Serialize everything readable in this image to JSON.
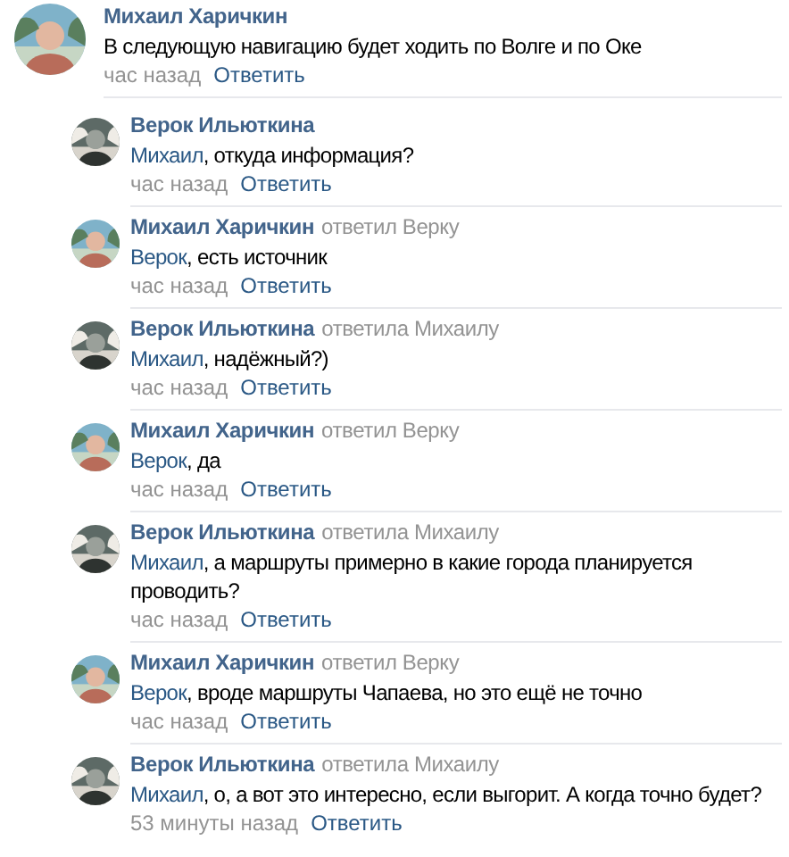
{
  "comment": {
    "author": "Михаил Харичкин",
    "text": "В следующую навигацию будет ходить по Волге и по Оке",
    "time": "час назад",
    "reply_label": "Ответить"
  },
  "replies": [
    {
      "author": "Верок Ильюткина",
      "mention": "Михаил",
      "text": ", откуда информация?",
      "time": "час назад",
      "reply_label": "Ответить"
    },
    {
      "author": "Михаил Харичкин",
      "replied_to": "ответил Верку",
      "mention": "Верок",
      "text": ", есть источник",
      "time": "час назад",
      "reply_label": "Ответить"
    },
    {
      "author": "Верок Ильюткина",
      "replied_to": "ответила Михаилу",
      "mention": "Михаил",
      "text": ", надёжный?)",
      "time": "час назад",
      "reply_label": "Ответить"
    },
    {
      "author": "Михаил Харичкин",
      "replied_to": "ответил Верку",
      "mention": "Верок",
      "text": ", да",
      "time": "час назад",
      "reply_label": "Ответить"
    },
    {
      "author": "Верок Ильюткина",
      "replied_to": "ответила Михаилу",
      "mention": "Михаил",
      "text": ", а маршруты примерно в какие города планируется проводить?",
      "time": "час назад",
      "reply_label": "Ответить"
    },
    {
      "author": "Михаил Харичкин",
      "replied_to": "ответил Верку",
      "mention": "Верок",
      "text": ", вроде маршруты Чапаева, но это ещё не точно",
      "time": "час назад",
      "reply_label": "Ответить"
    },
    {
      "author": "Верок Ильюткина",
      "replied_to": "ответила Михаилу",
      "mention": "Михаил",
      "text": ", о, а вот это интересно, если выгорит. А когда точно будет?",
      "time": "53 минуты назад",
      "reply_label": "Ответить"
    }
  ]
}
